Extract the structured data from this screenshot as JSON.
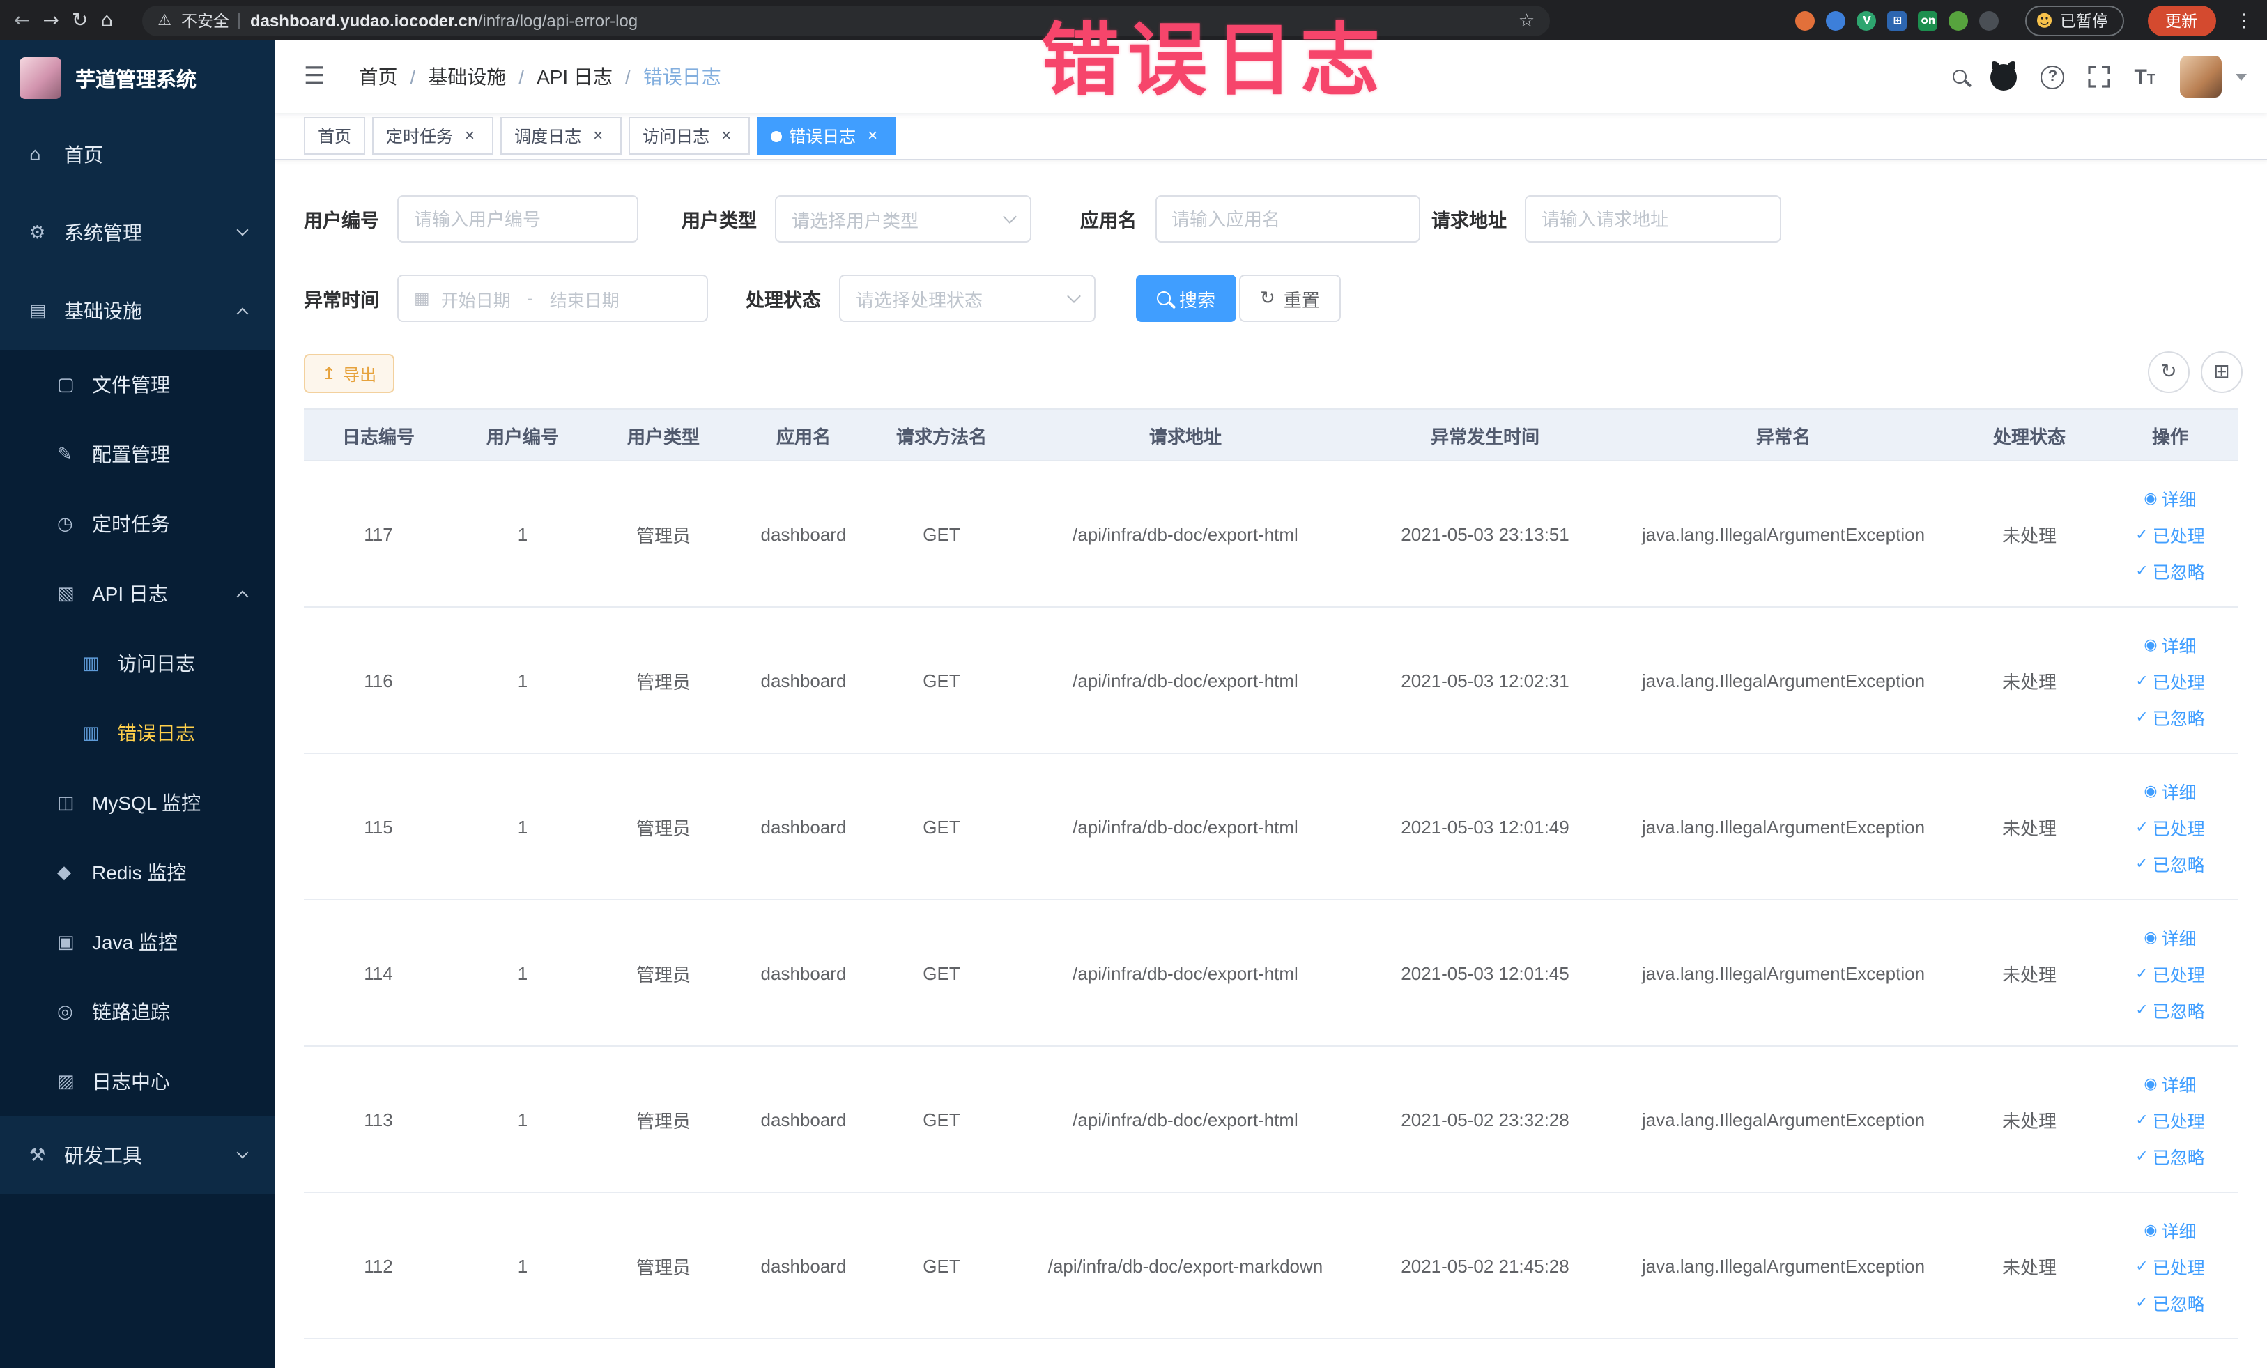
{
  "colors": {
    "primary": "#409eff",
    "sidebar_bg": "#0d2a45",
    "sidebar_sub_bg": "#071e35",
    "active_menu_text": "#ffd04b",
    "annotation": "#f6456b",
    "warning": "#e6a23c",
    "table_header_bg": "#ecf1f8"
  },
  "browser": {
    "security_label": "不安全",
    "url_domain": "dashboard.yudao.iocoder.cn",
    "url_path": "/infra/log/api-error-log",
    "paused_label": "已暂停",
    "update_label": "更新",
    "extensions": [
      {
        "key": "extension-orange-icon",
        "shape": "circle",
        "color": "#e2703a",
        "glyph": ""
      },
      {
        "key": "extension-blue-drop-icon",
        "shape": "circle",
        "color": "#3d7fd9",
        "glyph": ""
      },
      {
        "key": "extension-vue-devtools-icon",
        "shape": "circle",
        "color": "#2ea56f",
        "glyph": "V"
      },
      {
        "key": "extension-grid-icon",
        "shape": "square",
        "color": "#2d66b0",
        "glyph": "⊞"
      },
      {
        "key": "extension-on-badge-icon",
        "shape": "square",
        "color": "#1d8f4f",
        "glyph": "on"
      },
      {
        "key": "extension-leaf-icon",
        "shape": "circle",
        "color": "#57a33e",
        "glyph": ""
      },
      {
        "key": "extension-paw-icon",
        "shape": "circle",
        "color": "#4a4f55",
        "glyph": ""
      }
    ]
  },
  "annotation": {
    "text": "错误日志"
  },
  "sidebar": {
    "logo_title": "芋道管理系统",
    "icon_glyphs": {
      "home-icon": "⌂",
      "system-icon": "⚙",
      "infra-icon": "▤",
      "file-icon": "▢",
      "config-icon": "✎",
      "job-icon": "◷",
      "api-log-icon": "▧",
      "access-log-icon": "▥",
      "error-log-icon": "▥",
      "mysql-icon": "◫",
      "redis-icon": "◆",
      "java-icon": "▣",
      "trace-icon": "◎",
      "log-center-icon": "▨",
      "tools-icon": "⚒"
    },
    "items": [
      {
        "key": "home",
        "label": "首页",
        "icon": "home-icon",
        "level": 1
      },
      {
        "key": "system",
        "label": "系统管理",
        "icon": "system-icon",
        "level": 1,
        "arrow": "down"
      },
      {
        "key": "infra",
        "label": "基础设施",
        "icon": "infra-icon",
        "level": 1,
        "arrow": "up"
      },
      {
        "key": "file-manage",
        "label": "文件管理",
        "icon": "file-icon",
        "level": 2
      },
      {
        "key": "config-manage",
        "label": "配置管理",
        "icon": "config-icon",
        "level": 2
      },
      {
        "key": "job",
        "label": "定时任务",
        "icon": "job-icon",
        "level": 2
      },
      {
        "key": "api-log",
        "label": "API 日志",
        "icon": "api-log-icon",
        "level": 2,
        "arrow": "up"
      },
      {
        "key": "access-log",
        "label": "访问日志",
        "icon": "access-log-icon",
        "level": 3
      },
      {
        "key": "error-log",
        "label": "错误日志",
        "icon": "error-log-icon",
        "level": 3,
        "active": true
      },
      {
        "key": "mysql",
        "label": "MySQL 监控",
        "icon": "mysql-icon",
        "level": 2
      },
      {
        "key": "redis",
        "label": "Redis 监控",
        "icon": "redis-icon",
        "level": 2
      },
      {
        "key": "java",
        "label": "Java 监控",
        "icon": "java-icon",
        "level": 2
      },
      {
        "key": "trace",
        "label": "链路追踪",
        "icon": "trace-icon",
        "level": 2
      },
      {
        "key": "log-center",
        "label": "日志中心",
        "icon": "log-center-icon",
        "level": 2
      },
      {
        "key": "dev-tools",
        "label": "研发工具",
        "icon": "tools-icon",
        "level": 1,
        "arrow": "down"
      }
    ]
  },
  "navbar": {
    "breadcrumb": [
      "首页",
      "基础设施",
      "API 日志",
      "错误日志"
    ]
  },
  "tabs": [
    {
      "key": "home",
      "label": "首页",
      "closable": false,
      "active": false
    },
    {
      "key": "job",
      "label": "定时任务",
      "closable": true,
      "active": false
    },
    {
      "key": "job-log",
      "label": "调度日志",
      "closable": true,
      "active": false
    },
    {
      "key": "access-log",
      "label": "访问日志",
      "closable": true,
      "active": false
    },
    {
      "key": "error-log",
      "label": "错误日志",
      "closable": true,
      "active": true
    }
  ],
  "filters": {
    "user_id": {
      "label": "用户编号",
      "placeholder": "请输入用户编号"
    },
    "user_type": {
      "label": "用户类型",
      "placeholder": "请选择用户类型"
    },
    "app_name": {
      "label": "应用名",
      "placeholder": "请输入应用名"
    },
    "request_url": {
      "label": "请求地址",
      "placeholder": "请输入请求地址"
    },
    "exception_time": {
      "label": "异常时间",
      "start_placeholder": "开始日期",
      "separator": "-",
      "end_placeholder": "结束日期"
    },
    "process_status": {
      "label": "处理状态",
      "placeholder": "请选择处理状态"
    },
    "search_button": "搜索",
    "reset_button": "重置"
  },
  "toolbar": {
    "export_label": "导出"
  },
  "table": {
    "columns": [
      "日志编号",
      "用户编号",
      "用户类型",
      "应用名",
      "请求方法名",
      "请求地址",
      "异常发生时间",
      "异常名",
      "处理状态",
      "操作"
    ],
    "action_labels": {
      "detail": "详细",
      "processed": "已处理",
      "ignored": "已忽略"
    },
    "rows": [
      {
        "id": "117",
        "user_id": "1",
        "user_type": "管理员",
        "app": "dashboard",
        "method": "GET",
        "url": "/api/infra/db-doc/export-html",
        "time": "2021-05-03 23:13:51",
        "exception": "java.lang.IllegalArgumentException",
        "status": "未处理"
      },
      {
        "id": "116",
        "user_id": "1",
        "user_type": "管理员",
        "app": "dashboard",
        "method": "GET",
        "url": "/api/infra/db-doc/export-html",
        "time": "2021-05-03 12:02:31",
        "exception": "java.lang.IllegalArgumentException",
        "status": "未处理"
      },
      {
        "id": "115",
        "user_id": "1",
        "user_type": "管理员",
        "app": "dashboard",
        "method": "GET",
        "url": "/api/infra/db-doc/export-html",
        "time": "2021-05-03 12:01:49",
        "exception": "java.lang.IllegalArgumentException",
        "status": "未处理"
      },
      {
        "id": "114",
        "user_id": "1",
        "user_type": "管理员",
        "app": "dashboard",
        "method": "GET",
        "url": "/api/infra/db-doc/export-html",
        "time": "2021-05-03 12:01:45",
        "exception": "java.lang.IllegalArgumentException",
        "status": "未处理"
      },
      {
        "id": "113",
        "user_id": "1",
        "user_type": "管理员",
        "app": "dashboard",
        "method": "GET",
        "url": "/api/infra/db-doc/export-html",
        "time": "2021-05-02 23:32:28",
        "exception": "java.lang.IllegalArgumentException",
        "status": "未处理"
      },
      {
        "id": "112",
        "user_id": "1",
        "user_type": "管理员",
        "app": "dashboard",
        "method": "GET",
        "url": "/api/infra/db-doc/export-markdown",
        "time": "2021-05-02 21:45:28",
        "exception": "java.lang.IllegalArgumentException",
        "status": "未处理"
      }
    ]
  }
}
